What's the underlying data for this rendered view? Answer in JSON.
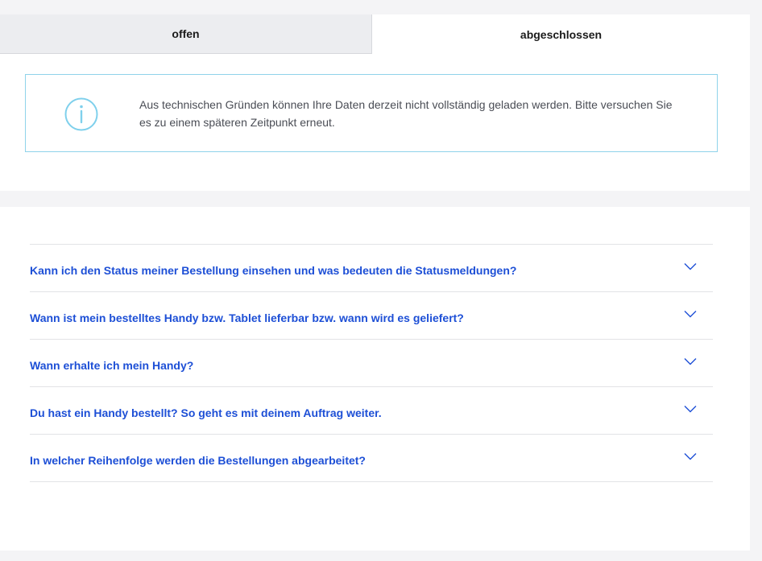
{
  "tabs": {
    "open_label": "offen",
    "closed_label": "abgeschlossen",
    "active": "abgeschlossen"
  },
  "info": {
    "icon": "info-icon",
    "message": "Aus technischen Gründen können Ihre Daten derzeit nicht vollständig geladen werden. Bitte versuchen Sie es zu einem späteren Zeitpunkt erneut."
  },
  "faq": {
    "items": [
      {
        "question": "Kann ich den Status meiner Bestellung einsehen und was bedeuten die Statusmeldungen?"
      },
      {
        "question": "Wann ist mein bestelltes Handy bzw. Tablet lieferbar bzw. wann wird es geliefert?"
      },
      {
        "question": "Wann erhalte ich mein Handy?"
      },
      {
        "question": "Du hast ein Handy bestellt? So geht es mit deinem Auftrag weiter."
      },
      {
        "question": "In welcher Reihenfolge werden die Bestellungen abgearbeitet?"
      }
    ]
  },
  "colors": {
    "link_blue": "#1d4fd6",
    "info_border": "#8fd3ea",
    "info_icon": "#7fd0ec",
    "page_bg": "#f4f4f6"
  }
}
